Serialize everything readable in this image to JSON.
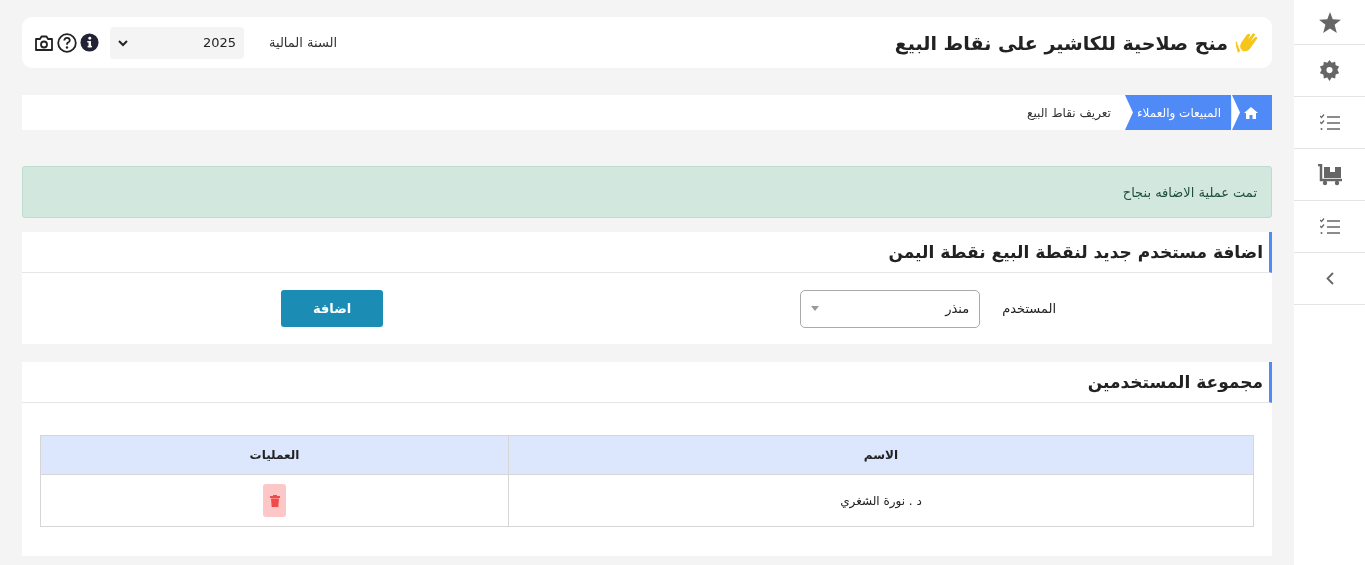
{
  "header": {
    "title": "منح صلاحية للكاشير على نقاط البيع",
    "fiscal_year_label": "السنة المالية",
    "fiscal_year": "2025"
  },
  "breadcrumb": [
    {
      "label": "المبيعات والعملاء",
      "kind": "link"
    },
    {
      "label": "تعريف نقاط البيع",
      "kind": "current"
    }
  ],
  "alert": {
    "text": "تمت عملية الاضافه بنجاح"
  },
  "add_user": {
    "title": "اضافة مستخدم جديد لنقطة البيع نقطة اليمن",
    "field_label": "المستخدم",
    "field_value": "منذر",
    "button": "اضافة"
  },
  "users": {
    "title": "مجموعة المستخدمين",
    "columns": [
      "الاسم",
      "العمليات"
    ],
    "rows": [
      {
        "name": "د . نورة الشغري"
      }
    ]
  }
}
